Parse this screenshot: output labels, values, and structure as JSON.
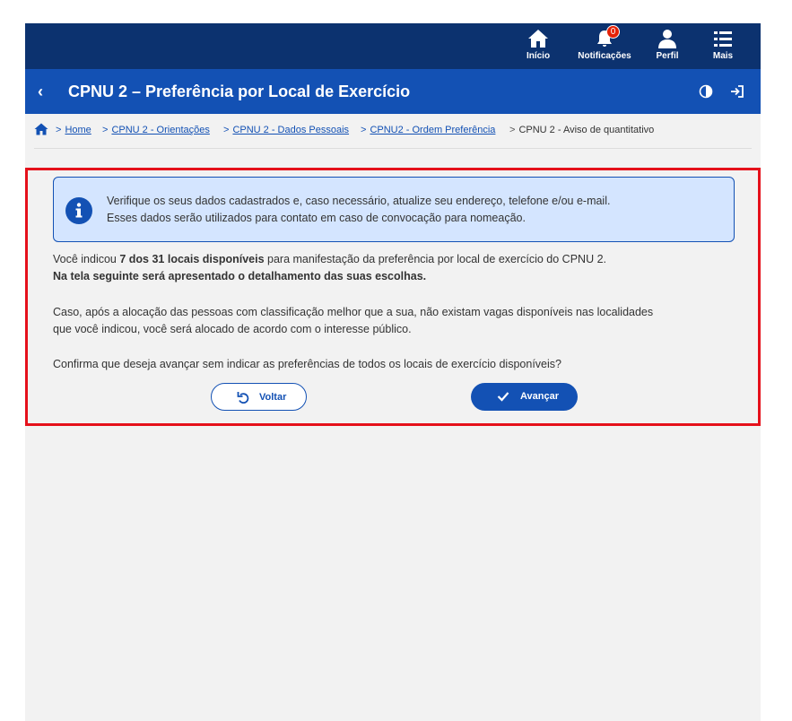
{
  "nav": {
    "items": [
      {
        "label": "Início",
        "icon": "home-icon"
      },
      {
        "label": "Notificações",
        "icon": "bell-icon",
        "badge": "0"
      },
      {
        "label": "Perfil",
        "icon": "user-icon"
      },
      {
        "label": "Mais",
        "icon": "list-icon"
      }
    ]
  },
  "titlebar": {
    "title": "CPNU 2 – Preferência por Local de Exercício",
    "back_glyph": "‹"
  },
  "breadcrumb": {
    "sep": ">",
    "items": [
      "Home",
      "CPNU 2 - Orientações",
      "CPNU 2 - Dados Pessoais",
      "CPNU2 - Ordem Preferência"
    ],
    "current": "CPNU 2 - Aviso de quantitativo"
  },
  "alert": {
    "line1": "Verifique os seus dados cadastrados e, caso necessário, atualize seu endereço, telefone e/ou e-mail.",
    "line2": "Esses dados serão utilizados para contato em caso de convocação para nomeação."
  },
  "content": {
    "p1_a": "Você indicou ",
    "p1_b": "7 dos 31 locais disponíveis",
    "p1_c": " para manifestação da preferência por local de exercício do CPNU 2.",
    "p2": "Na tela seguinte será apresentado o detalhamento das suas escolhas.",
    "p3_l1": "Caso, após a alocação das pessoas com classificação melhor que a sua, não existam vagas disponíveis nas localidades",
    "p3_l2": "que você indicou, você será alocado de acordo com o interesse público.",
    "p4": "Confirma que deseja avançar sem indicar as preferências de todos os locais de exercício disponíveis?"
  },
  "buttons": {
    "back": "Voltar",
    "next": "Avançar"
  },
  "colors": {
    "nav_bg": "#0c326f",
    "title_bg": "#1351b4",
    "highlight_border": "#e5111b",
    "alert_bg": "#d4e5ff"
  }
}
